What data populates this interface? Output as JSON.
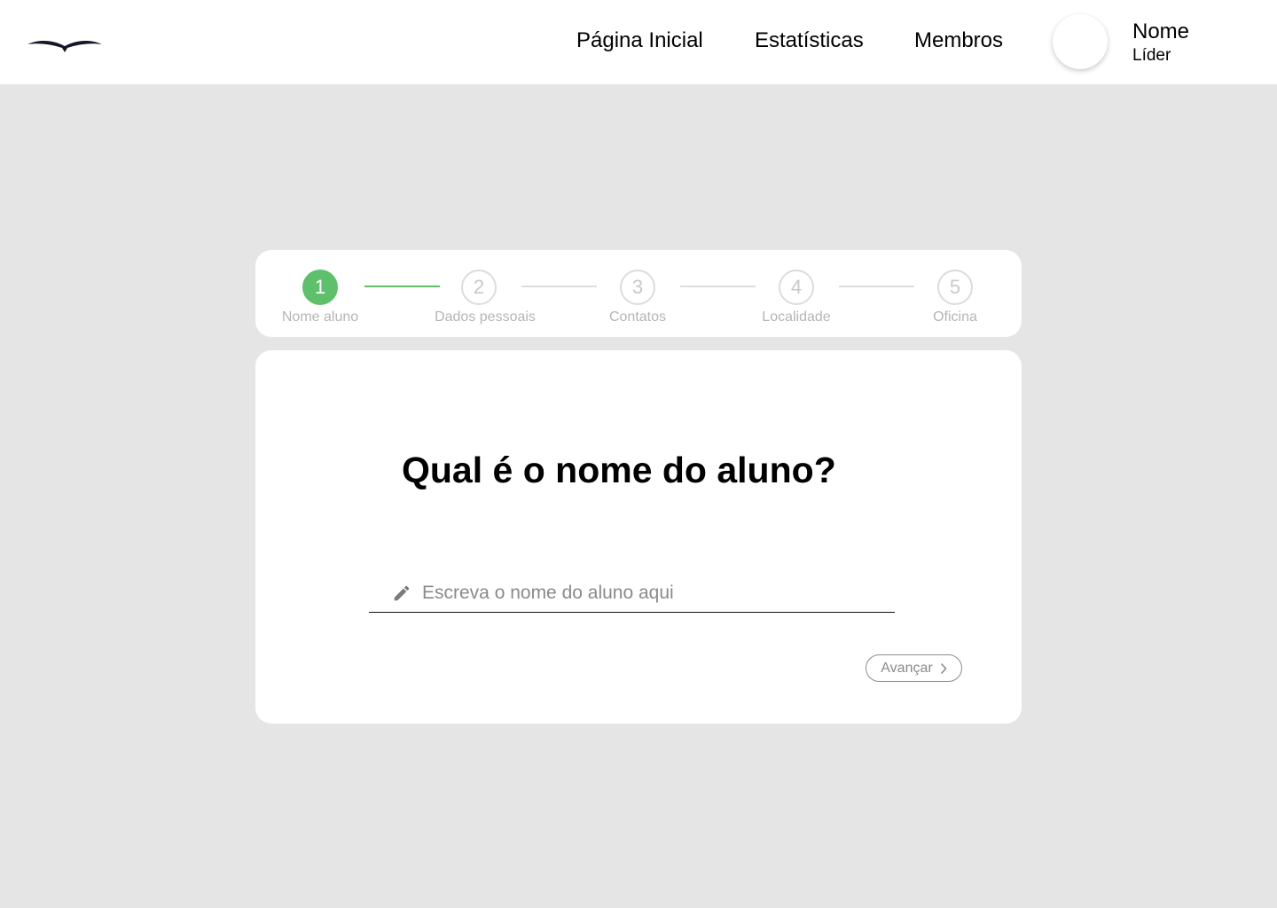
{
  "header": {
    "nav": [
      {
        "label": "Página Inicial"
      },
      {
        "label": "Estatísticas"
      },
      {
        "label": "Membros"
      }
    ],
    "user": {
      "name": "Nome",
      "role": "Líder"
    }
  },
  "stepper": {
    "current_step": 1,
    "steps": [
      {
        "number": "1",
        "label": "Nome aluno"
      },
      {
        "number": "2",
        "label": "Dados pessoais"
      },
      {
        "number": "3",
        "label": "Contatos"
      },
      {
        "number": "4",
        "label": "Localidade"
      },
      {
        "number": "5",
        "label": "Oficina"
      }
    ]
  },
  "form": {
    "question": "Qual é o nome do aluno?",
    "name_input": {
      "value": "",
      "placeholder": "Escreva o nome do aluno aqui"
    },
    "next_label": "Avançar"
  },
  "colors": {
    "accent": "#5fc06c",
    "background": "#e5e5e5"
  },
  "icons": [
    "bird-logo-icon",
    "pencil-icon",
    "chevron-right-icon"
  ]
}
